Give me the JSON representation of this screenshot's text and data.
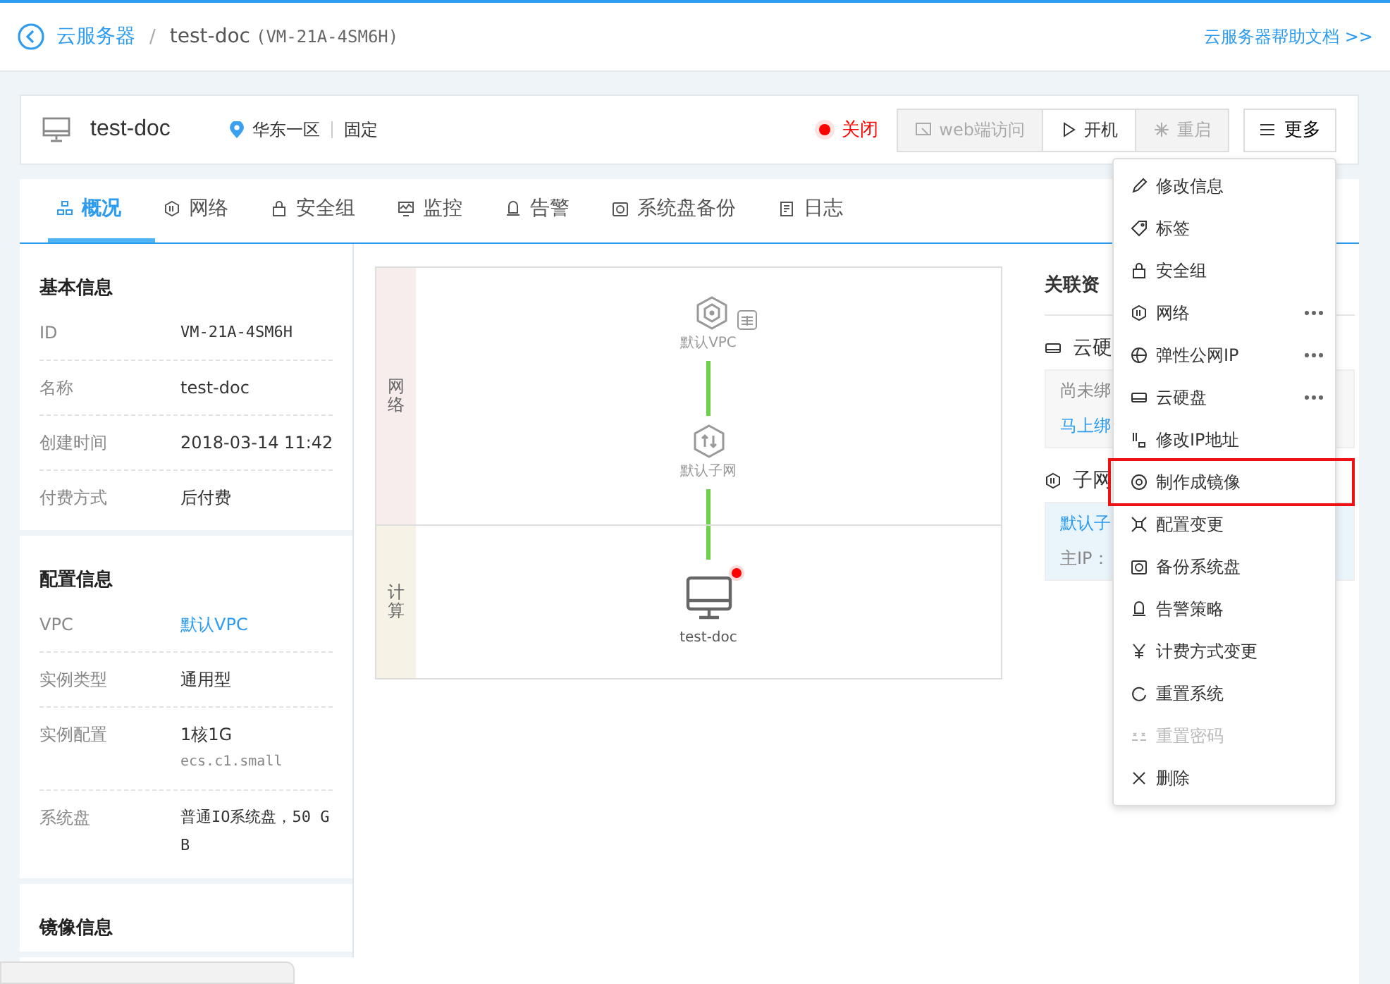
{
  "header": {
    "back": "云服务器",
    "separator": "/",
    "title": "test-doc",
    "id": "(VM-21A-4SM6H)",
    "help_link": "云服务器帮助文档 >>"
  },
  "instance": {
    "name": "test-doc",
    "region": "华东一区",
    "network_type": "固定",
    "status": "关闭",
    "actions": [
      {
        "label": "web端访问",
        "disabled": true,
        "kind": "web"
      },
      {
        "label": "开机",
        "disabled": false,
        "kind": "start"
      },
      {
        "label": "重启",
        "disabled": true,
        "kind": "restart"
      }
    ],
    "more": "更多"
  },
  "tabs": [
    {
      "label": "概况",
      "selected": true,
      "kind": "overview"
    },
    {
      "label": "网络",
      "selected": false,
      "kind": "network"
    },
    {
      "label": "安全组",
      "selected": false,
      "kind": "security"
    },
    {
      "label": "监控",
      "selected": false,
      "kind": "monitor"
    },
    {
      "label": "告警",
      "selected": false,
      "kind": "alarm"
    },
    {
      "label": "系统盘备份",
      "selected": false,
      "kind": "backup"
    },
    {
      "label": "日志",
      "selected": false,
      "kind": "log"
    }
  ],
  "sections": [
    {
      "title": "基本信息",
      "rows": [
        {
          "label": "ID",
          "value": "VM-21A-4SM6H",
          "kind": "mono"
        },
        {
          "label": "名称",
          "value": "test-doc",
          "kind": "text"
        },
        {
          "label": "创建时间",
          "value": "2018-03-14 11:42",
          "kind": "text"
        },
        {
          "label": "付费方式",
          "value": "后付费",
          "kind": "text"
        }
      ]
    },
    {
      "title": "配置信息",
      "rows": [
        {
          "label": "VPC",
          "value": "默认VPC",
          "kind": "link"
        },
        {
          "label": "实例类型",
          "value": "通用型",
          "kind": "text"
        },
        {
          "label": "实例配置",
          "value": "1核1G",
          "sub": "ecs.c1.small",
          "kind": "text"
        },
        {
          "label": "系统盘",
          "value": "普通IO系统盘，50 GB",
          "kind": "mono"
        }
      ]
    },
    {
      "title": "镜像信息"
    }
  ],
  "topology": {
    "lanes": [
      {
        "label": "网络",
        "color": "#f8eded"
      },
      {
        "label": "计算",
        "color": "#f6f2e6"
      }
    ],
    "nodes": [
      {
        "label": "默认VPC",
        "kind": "vpc"
      },
      {
        "label": "默认子网",
        "kind": "subnet"
      },
      {
        "label": "test-doc",
        "kind": "server"
      }
    ]
  },
  "related": {
    "title": "关联资",
    "disk": {
      "title": "云硬",
      "empty": "尚未绑",
      "bind": "马上绑"
    },
    "subnet": {
      "title": "子网",
      "name": "默认子",
      "ip": "主IP："
    }
  },
  "menu": [
    {
      "label": "修改信息",
      "kind": "edit",
      "disabled": false,
      "more": false,
      "highlighted": false
    },
    {
      "label": "标签",
      "kind": "tag",
      "disabled": false,
      "more": false,
      "highlighted": false
    },
    {
      "label": "安全组",
      "kind": "security",
      "disabled": false,
      "more": false,
      "highlighted": false
    },
    {
      "label": "网络",
      "kind": "network",
      "disabled": false,
      "more": true,
      "highlighted": false
    },
    {
      "label": "弹性公网IP",
      "kind": "globe",
      "disabled": false,
      "more": true,
      "highlighted": false
    },
    {
      "label": "云硬盘",
      "kind": "disk",
      "disabled": false,
      "more": true,
      "highlighted": false
    },
    {
      "label": "修改IP地址",
      "kind": "ip",
      "disabled": false,
      "more": false,
      "highlighted": false
    },
    {
      "label": "制作成镜像",
      "kind": "image",
      "disabled": false,
      "more": false,
      "highlighted": true
    },
    {
      "label": "配置变更",
      "kind": "resize",
      "disabled": false,
      "more": false,
      "highlighted": false
    },
    {
      "label": "备份系统盘",
      "kind": "backup",
      "disabled": false,
      "more": false,
      "highlighted": false
    },
    {
      "label": "告警策略",
      "kind": "alarm",
      "disabled": false,
      "more": false,
      "highlighted": false
    },
    {
      "label": "计费方式变更",
      "kind": "yen",
      "disabled": false,
      "more": false,
      "highlighted": false
    },
    {
      "label": "重置系统",
      "kind": "reset",
      "disabled": false,
      "more": false,
      "highlighted": false
    },
    {
      "label": "重置密码",
      "kind": "password",
      "disabled": true,
      "more": false,
      "highlighted": false
    },
    {
      "label": "删除",
      "kind": "delete",
      "disabled": false,
      "more": false,
      "highlighted": false
    }
  ]
}
